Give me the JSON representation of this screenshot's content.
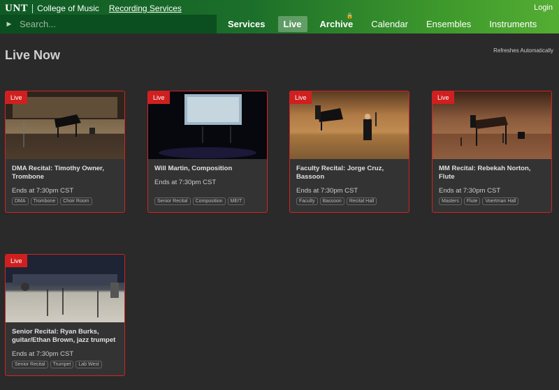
{
  "header": {
    "logo": "UNT",
    "school": "College of Music",
    "service_link": "Recording Services",
    "login": "Login"
  },
  "search": {
    "placeholder": "Search..."
  },
  "nav": [
    {
      "label": "Services",
      "bold": true
    },
    {
      "label": "Live",
      "active": true
    },
    {
      "label": "Archive",
      "bold": true,
      "locked": true
    },
    {
      "label": "Calendar"
    },
    {
      "label": "Ensembles"
    },
    {
      "label": "Instruments"
    }
  ],
  "page": {
    "title": "Live Now",
    "refresh_note": "Refreshes Automatically"
  },
  "badge_label": "Live",
  "cards": [
    {
      "title": "DMA Recital: Timothy Owner, Trombone",
      "time": "Ends at 7:30pm CST",
      "tags": [
        "DMA",
        "Trombone",
        "Choir Room"
      ]
    },
    {
      "title": "Will Martin, Composition",
      "time": "Ends at 7:30pm CST",
      "tags": [
        "Senior Recital",
        "Composition",
        "MEIT"
      ]
    },
    {
      "title": "Faculty Recital: Jorge Cruz, Bassoon",
      "time": "Ends at 7:30pm CST",
      "tags": [
        "Faculty",
        "Bassoon",
        "Recital Hall"
      ]
    },
    {
      "title": "MM Recital: Rebekah Norton, Flute",
      "time": "Ends at 7:30pm CST",
      "tags": [
        "Masters",
        "Flute",
        "Voertman Hall"
      ]
    },
    {
      "title": "Senior Recital: Ryan Burks, guitar/Ethan Brown, jazz trumpet",
      "time": "Ends at 7:30pm CST",
      "tags": [
        "Senior Recital",
        "Trumpet",
        "Lab West"
      ]
    }
  ],
  "colors": {
    "live_border": "#d42323",
    "header_green": "#1c6f2a",
    "background": "#2a2a2a"
  }
}
